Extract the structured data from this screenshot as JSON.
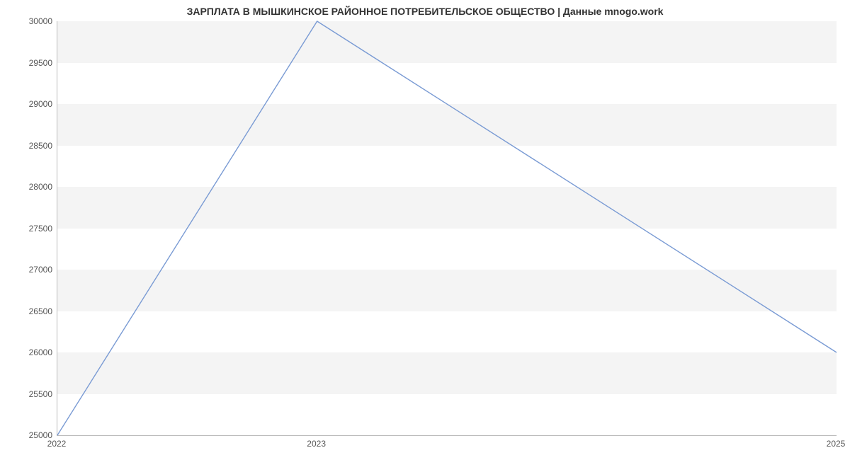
{
  "chart_data": {
    "type": "line",
    "title": "ЗАРПЛАТА В МЫШКИНСКОЕ РАЙОННОЕ ПОТРЕБИТЕЛЬСКОЕ ОБЩЕСТВО | Данные mnogo.work",
    "xlabel": "",
    "ylabel": "",
    "x": [
      2022,
      2023,
      2025
    ],
    "values": [
      25000,
      30000,
      26000
    ],
    "x_ticks": [
      2022,
      2023,
      2025
    ],
    "y_ticks": [
      25000,
      25500,
      26000,
      26500,
      27000,
      27500,
      28000,
      28500,
      29000,
      29500,
      30000
    ],
    "xlim": [
      2022,
      2025
    ],
    "ylim": [
      25000,
      30000
    ],
    "grid": true,
    "line_color": "#7a9bd4"
  }
}
